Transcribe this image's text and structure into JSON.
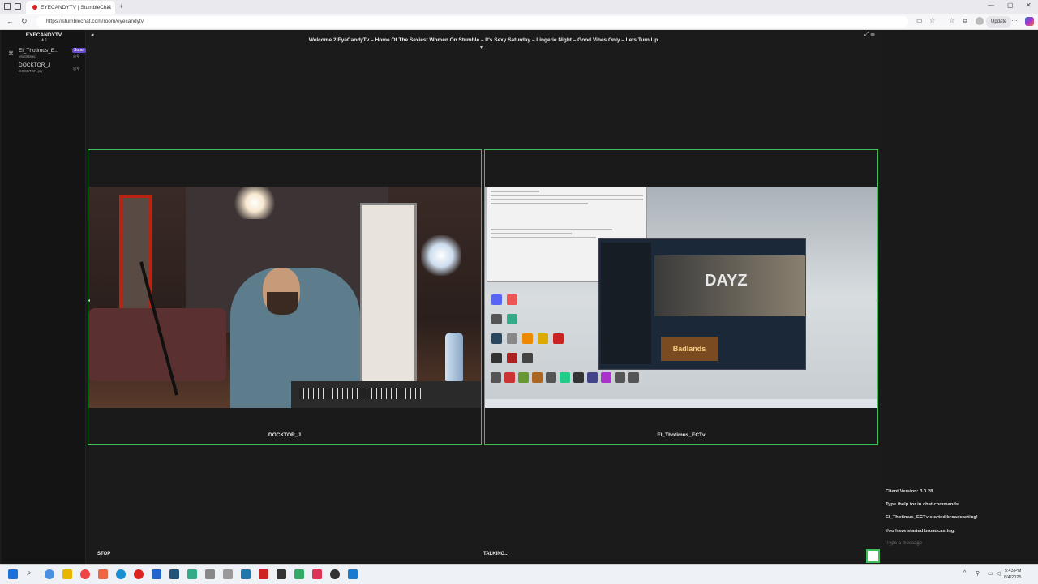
{
  "browser": {
    "tab_title": "EYECANDYTV | StumbleChat",
    "url": "https://stumblechat.com/room/eyecandytv",
    "update_label": "Update"
  },
  "room": {
    "name": "EYECANDYTV",
    "user_count": "2",
    "topic": "Welcome 2 EyeCandyTv – Home Of The Sexiest Women On Stumble – It's Sexy Saturday – Lingerie Night – Good Vibes Only – Lets Turn Up"
  },
  "users": [
    {
      "name": "El_Thotimus_E...",
      "sub": "MostHated",
      "badge": "Super"
    },
    {
      "name": "DOCKTOR_J",
      "sub": "DOCKTOR.jay",
      "badge": ""
    }
  ],
  "tiles": [
    {
      "label": "DOCKTOR_J"
    },
    {
      "label": "El_Thotimus_ECTv"
    }
  ],
  "chat": {
    "messages": [
      "Client Version: 3.0.28",
      "Type /help for in chat commands.",
      "El_Thotimus_ECTv started broadcasting!",
      "You have started broadcasting."
    ],
    "input_placeholder": "Type a message"
  },
  "controls": {
    "stop_label": "STOP",
    "talking_label": "TALKING..."
  },
  "screen_share": {
    "game_title": "DAYZ",
    "game_sub": "Badlands"
  },
  "clock": {
    "time": "5:43 PM",
    "date": "8/4/2025"
  },
  "colors": {
    "active_border": "#3fbf5a",
    "super_badge": "#6a4bd0"
  }
}
